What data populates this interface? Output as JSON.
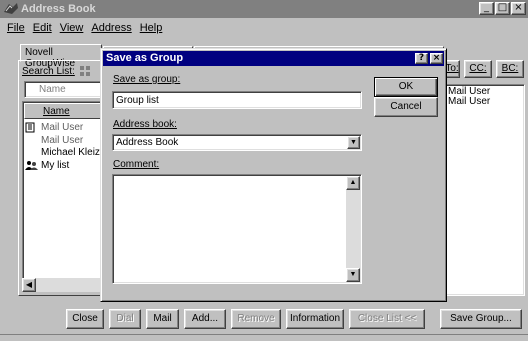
{
  "window": {
    "title": "Address Book",
    "controls": [
      "minimize-icon",
      "maximize-icon",
      "close-icon"
    ]
  },
  "menu": {
    "items": [
      "File",
      "Edit",
      "View",
      "Address",
      "Help"
    ]
  },
  "tabs": {
    "active": "Novell GroupWise"
  },
  "left_panel": {
    "search_label": "Search List:",
    "name_placeholder": "Name",
    "column_header": "Name",
    "rows": [
      {
        "text": "Mail User",
        "icon": "address-card-icon",
        "dim": true
      },
      {
        "text": "Mail User",
        "icon": "",
        "dim": true
      },
      {
        "text": "Michael Kleiza",
        "icon": "",
        "dim": false
      },
      {
        "text": "My list",
        "icon": "group-icon",
        "dim": false
      }
    ]
  },
  "right_panel": {
    "to_label": "To:",
    "cc_label": "CC:",
    "bc_label": "BC:",
    "rows": [
      "Mail User",
      "Mail User"
    ]
  },
  "bottom_buttons": {
    "close": "Close",
    "dial": "Dial",
    "mail": "Mail",
    "add": "Add...",
    "remove": "Remove",
    "information": "Information",
    "close_list": "Close List <<",
    "save_group": "Save Group..."
  },
  "dialog": {
    "title": "Save as Group",
    "save_as_label": "Save as group:",
    "save_as_value": "Group list",
    "address_book_label": "Address book:",
    "address_book_value": "Address Book",
    "comment_label": "Comment:",
    "comment_value": "",
    "ok": "OK",
    "cancel": "Cancel"
  },
  "colors": {
    "face": "#c0c0c0",
    "active_title": "#000080",
    "inactive_title": "#808080"
  }
}
